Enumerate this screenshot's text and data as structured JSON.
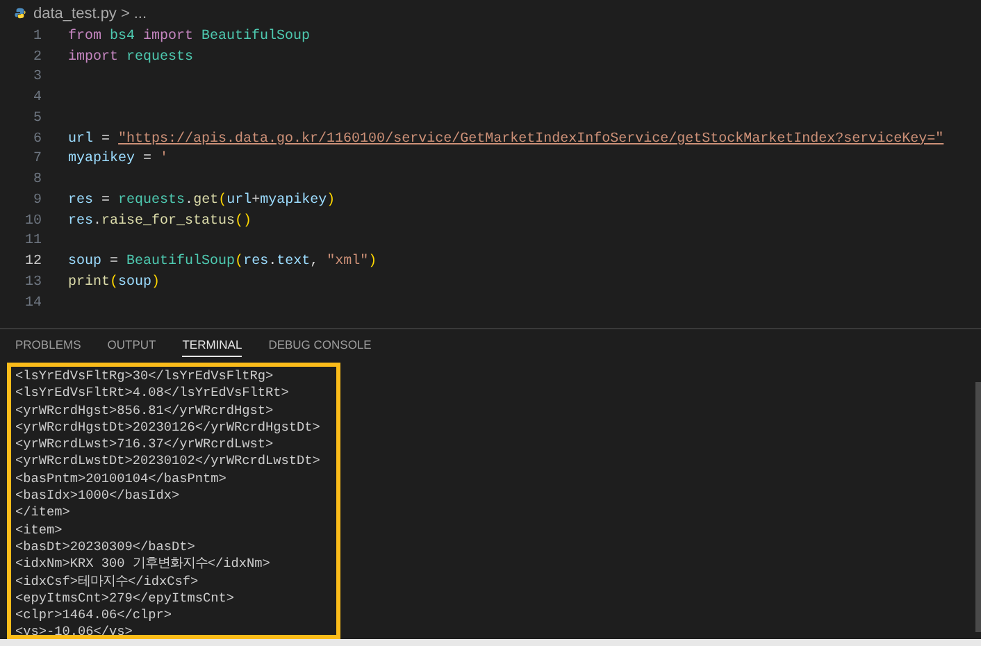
{
  "breadcrumb": {
    "file": "data_test.py",
    "separator": ">",
    "rest": "..."
  },
  "editor": {
    "lines": [
      {
        "number": "1",
        "current": false,
        "tokens": [
          {
            "kind": "kw",
            "text": "from "
          },
          {
            "kind": "cls",
            "text": "bs4 "
          },
          {
            "kind": "kw",
            "text": "import "
          },
          {
            "kind": "cls",
            "text": "BeautifulSoup"
          }
        ]
      },
      {
        "number": "2",
        "current": false,
        "tokens": [
          {
            "kind": "kw",
            "text": "import "
          },
          {
            "kind": "cls",
            "text": "requests"
          }
        ]
      },
      {
        "number": "3",
        "current": false
      },
      {
        "number": "4",
        "current": false
      },
      {
        "number": "5",
        "current": false
      },
      {
        "number": "6",
        "current": false,
        "tokens": [
          {
            "kind": "var",
            "text": "url"
          },
          {
            "kind": "plain",
            "text": " = "
          },
          {
            "kind": "link",
            "text": "\"https://apis.data.go.kr/1160100/service/GetMarketIndexInfoService/getStockMarketIndex?serviceKey=\""
          }
        ]
      },
      {
        "number": "7",
        "current": false,
        "tokens": [
          {
            "kind": "var",
            "text": "myapikey"
          },
          {
            "kind": "plain",
            "text": " = "
          },
          {
            "kind": "str",
            "text": "'"
          }
        ]
      },
      {
        "number": "8",
        "current": false
      },
      {
        "number": "9",
        "current": false,
        "tokens": [
          {
            "kind": "var",
            "text": "res"
          },
          {
            "kind": "plain",
            "text": " = "
          },
          {
            "kind": "cls",
            "text": "requests"
          },
          {
            "kind": "plain",
            "text": "."
          },
          {
            "kind": "fn",
            "text": "get"
          },
          {
            "kind": "paren",
            "text": "("
          },
          {
            "kind": "var",
            "text": "url"
          },
          {
            "kind": "plain",
            "text": "+"
          },
          {
            "kind": "var",
            "text": "myapikey"
          },
          {
            "kind": "paren",
            "text": ")"
          }
        ]
      },
      {
        "number": "10",
        "current": false,
        "tokens": [
          {
            "kind": "var",
            "text": "res"
          },
          {
            "kind": "plain",
            "text": "."
          },
          {
            "kind": "fn",
            "text": "raise_for_status"
          },
          {
            "kind": "paren",
            "text": "()"
          }
        ]
      },
      {
        "number": "11",
        "current": false
      },
      {
        "number": "12",
        "current": true,
        "tokens": [
          {
            "kind": "var",
            "text": "soup"
          },
          {
            "kind": "plain",
            "text": " = "
          },
          {
            "kind": "cls",
            "text": "BeautifulSoup"
          },
          {
            "kind": "paren",
            "text": "("
          },
          {
            "kind": "var",
            "text": "res"
          },
          {
            "kind": "plain",
            "text": "."
          },
          {
            "kind": "var",
            "text": "text"
          },
          {
            "kind": "plain",
            "text": ", "
          },
          {
            "kind": "str",
            "text": "\"xml\""
          },
          {
            "kind": "paren",
            "text": ")"
          }
        ]
      },
      {
        "number": "13",
        "current": false,
        "tokens": [
          {
            "kind": "fn",
            "text": "print"
          },
          {
            "kind": "paren",
            "text": "("
          },
          {
            "kind": "var",
            "text": "soup"
          },
          {
            "kind": "paren",
            "text": ")"
          }
        ]
      },
      {
        "number": "14",
        "current": false
      }
    ]
  },
  "panel": {
    "tabs": [
      {
        "label": "PROBLEMS",
        "selected": false
      },
      {
        "label": "OUTPUT",
        "selected": false
      },
      {
        "label": "TERMINAL",
        "selected": true
      },
      {
        "label": "DEBUG CONSOLE",
        "selected": false
      }
    ],
    "terminal": {
      "highlighted": true,
      "lines": [
        "<lsYrEdVsFltRg>30</lsYrEdVsFltRg>",
        "<lsYrEdVsFltRt>4.08</lsYrEdVsFltRt>",
        "<yrWRcrdHgst>856.81</yrWRcrdHgst>",
        "<yrWRcrdHgstDt>20230126</yrWRcrdHgstDt>",
        "<yrWRcrdLwst>716.37</yrWRcrdLwst>",
        "<yrWRcrdLwstDt>20230102</yrWRcrdLwstDt>",
        "<basPntm>20100104</basPntm>",
        "<basIdx>1000</basIdx>",
        "</item>",
        "<item>",
        "<basDt>20230309</basDt>",
        "<idxNm>KRX 300 기후변화지수</idxNm>",
        "<idxCsf>테마지수</idxCsf>",
        "<epyItmsCnt>279</epyItmsCnt>",
        "<clpr>1464.06</clpr>",
        "<vs>-10.06</vs>"
      ]
    }
  }
}
